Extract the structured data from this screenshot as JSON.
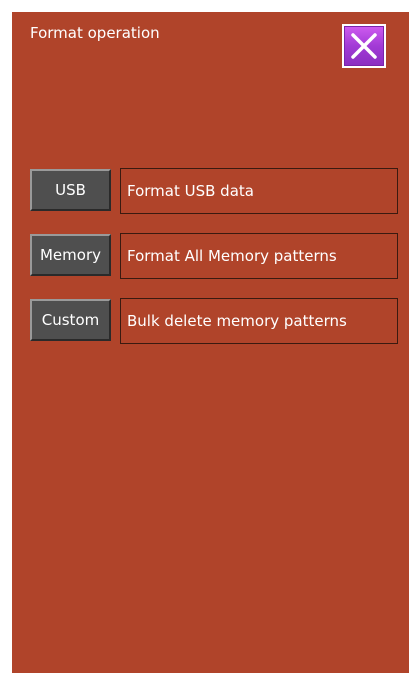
{
  "window": {
    "title": "Format operation"
  },
  "close_button": {
    "icon": "close-icon"
  },
  "options": [
    {
      "button_label": "USB",
      "description": "Format USB data"
    },
    {
      "button_label": "Memory",
      "description": "Format All Memory patterns"
    },
    {
      "button_label": "Custom",
      "description": "Bulk delete memory patterns"
    }
  ],
  "colors": {
    "background": "#b0442a",
    "button": "#4f4f4f",
    "close_button": "#b34ae0"
  }
}
